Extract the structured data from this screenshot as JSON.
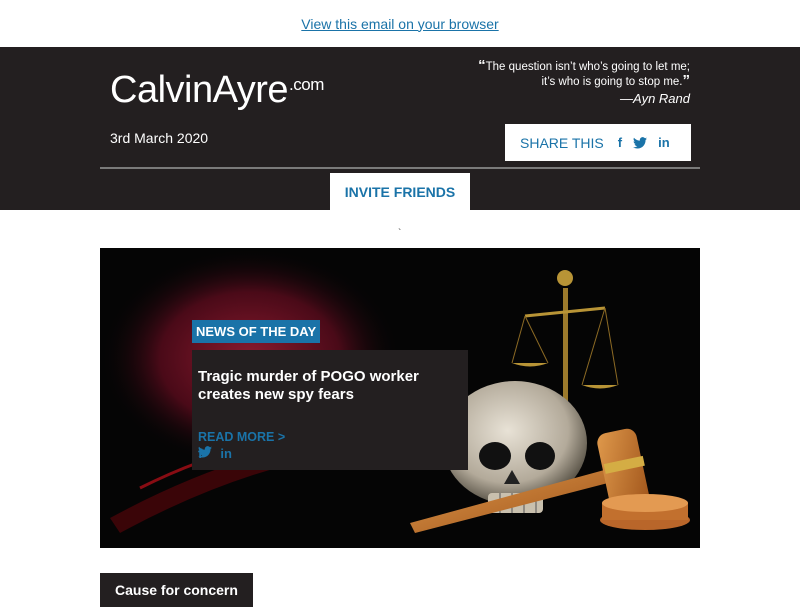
{
  "topbar": {
    "view_in_browser": "View this email on your browser"
  },
  "header": {
    "logo_main": "CalvinAyre",
    "logo_suffix": ".com",
    "quote_open": "“",
    "quote_line1": "The question isn’t who’s going to let me;",
    "quote_line2": "it’s who is going to stop me.",
    "quote_close": "”",
    "quote_author": "—Ayn Rand",
    "date": "3rd March 2020",
    "share_label": "SHARE THIS",
    "invite_label": "INVITE FRIENDS"
  },
  "stray_mark": "`",
  "hero": {
    "tag": "NEWS OF THE DAY",
    "title": "Tragic murder of POGO worker creates new spy fears",
    "read_more": "READ MORE >"
  },
  "section": {
    "title": "Cause for concern"
  },
  "icons": {
    "facebook": "f",
    "twitter": "twitter-icon",
    "linkedin": "in"
  },
  "colors": {
    "brand_blue": "#1a73a8",
    "dark_bg": "#231f20"
  }
}
